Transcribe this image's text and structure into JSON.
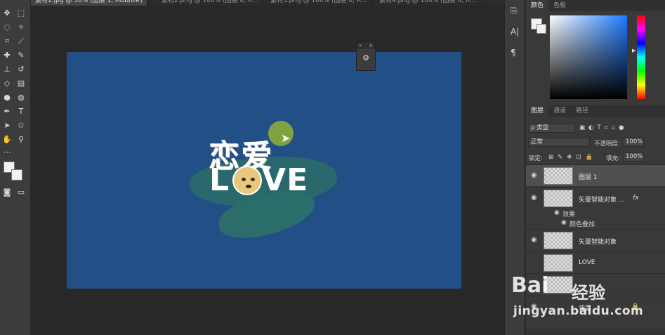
{
  "tabs": [
    {
      "label": "素材1.jpg @ 50% (图层 1, RGB/8#)"
    },
    {
      "label": "素材2.png @ 100% (图层 0, R..."
    },
    {
      "label": "素材3.png @ 100% (图层 0, R..."
    },
    {
      "label": "素材4.png @ 100% (图层 0, R..."
    }
  ],
  "color_panel": {
    "tabs": [
      "颜色",
      "色板"
    ]
  },
  "layers_panel": {
    "tabs": [
      "图层",
      "通道",
      "路径"
    ],
    "filter_kind": "ρ 类型",
    "blend_mode": "正常",
    "opacity_label": "不透明度:",
    "opacity_value": "100%",
    "lock_label": "锁定:",
    "fill_label": "填充:",
    "fill_value": "100%",
    "layers": [
      {
        "name": "图层 1",
        "visible": true,
        "active": true
      },
      {
        "name": "矢量智能对象 ...",
        "visible": true,
        "fx": "fx"
      },
      {
        "name": "矢量智能对象",
        "visible": true
      },
      {
        "name": "LOVE",
        "visible": false
      },
      {
        "name": "...",
        "visible": false
      },
      {
        "name": "背景",
        "visible": true,
        "locked": true
      }
    ],
    "effects_label": "效果",
    "effect_item": "颜色叠加"
  },
  "canvas": {
    "line1": "恋爱",
    "line2_left": "L",
    "line2_right": "VE",
    "bg_color": "#225086"
  },
  "watermark": {
    "brand": "Bai",
    "product": "经验",
    "url": "jingyan.baidu.com"
  },
  "colors": {
    "accent": "#225086",
    "panel": "#393939"
  }
}
